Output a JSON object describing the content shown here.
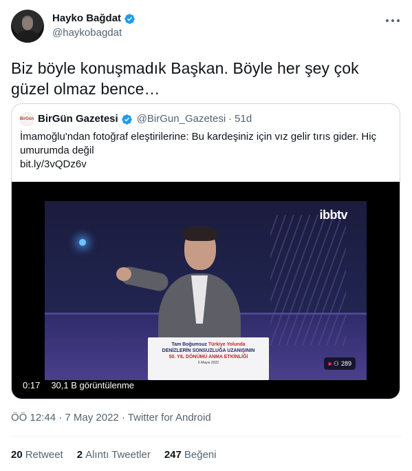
{
  "author": {
    "display_name": "Hayko Bağdat",
    "handle": "@haykobagdat",
    "verified_icon": "verified-badge-icon",
    "avatar_icon": "profile-photo"
  },
  "menu": {
    "icon": "more-horizontal-icon"
  },
  "tweet_text": "Biz böyle konuşmadık Başkan. Böyle her şey çok güzel olmaz bence…",
  "quote": {
    "avatar_label": "BirGün",
    "name": "BirGün Gazetesi",
    "handle": "@BirGun_Gazetesi",
    "separator": "·",
    "time": "51d",
    "text": "İmamoğlu'ndan fotoğraf eleştirilerine: Bu kardeşiniz için vız gelir tırıs gider. Hiç umurumda değil",
    "link": "bit.ly/3vQDz6v",
    "video": {
      "channel_logo": "ibbtv",
      "podium_line1": "Tam Boğumsuz",
      "podium_line1_b": "Türkiye Yolunda",
      "podium_line2": "DENİZLERİN SONSUZLUĞA UZANIŞININ",
      "podium_line3": "50. YIL DÖNÜMÜ ANMA ETKİNLİĞİ",
      "podium_line4": "6 Mayıs 2022",
      "live_viewers": "289",
      "duration": "0:17",
      "views": "30,1 B görüntülenme"
    }
  },
  "timestamp": "ÖÖ 12:44 · 7 May 2022 · Twitter for Android",
  "stats": {
    "retweets_count": "20",
    "retweets_label": "Retweet",
    "quotes_count": "2",
    "quotes_label": "Alıntı Tweetler",
    "likes_count": "247",
    "likes_label": "Beğeni"
  },
  "colors": {
    "text_primary": "#0f1419",
    "text_secondary": "#536471",
    "verified_blue": "#1d9bf0",
    "border": "#cfd9de"
  }
}
